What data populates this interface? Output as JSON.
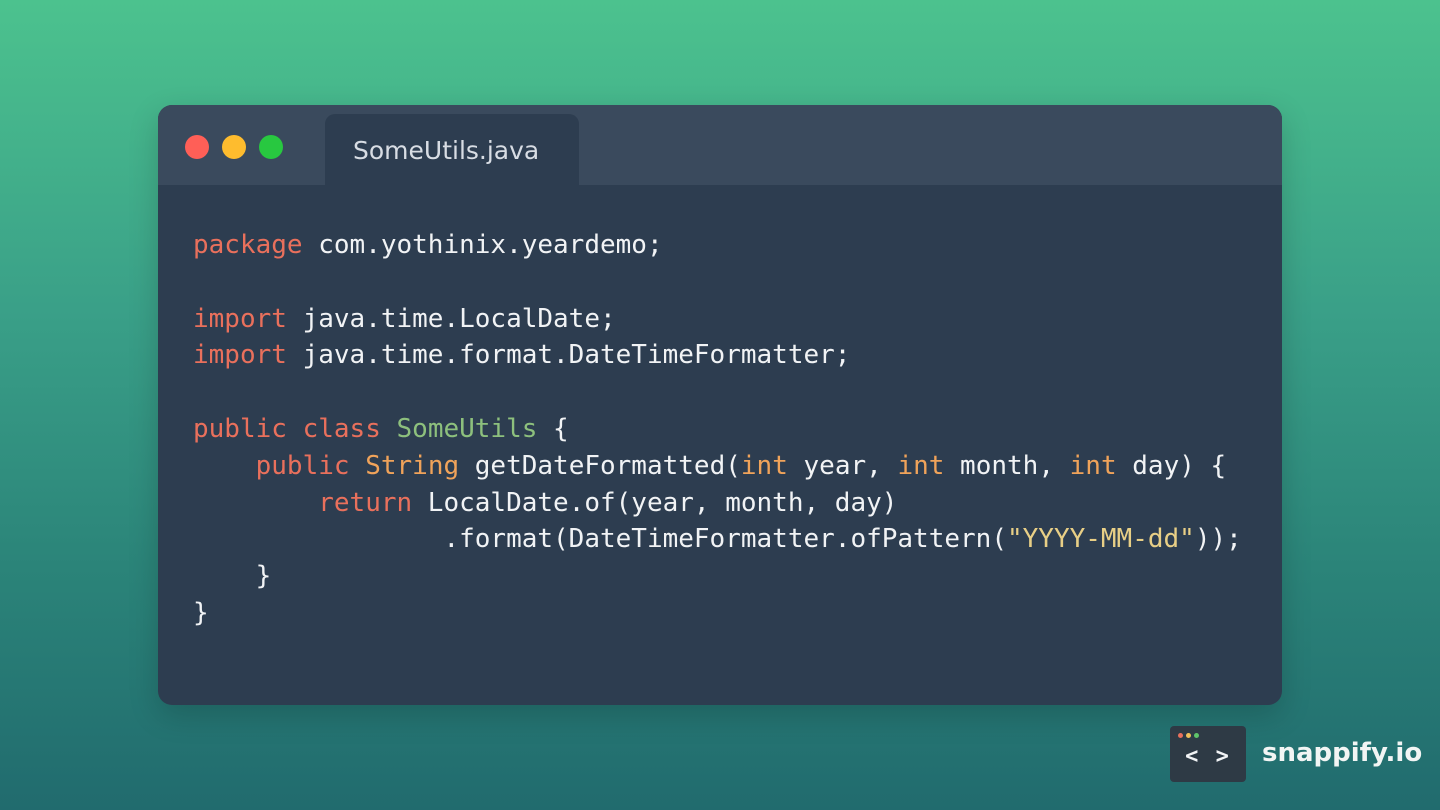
{
  "window": {
    "tab_title": "SomeUtils.java",
    "traffic_lights": [
      {
        "name": "close",
        "color": "#ff5f57"
      },
      {
        "name": "minimize",
        "color": "#febc2e"
      },
      {
        "name": "maximize",
        "color": "#28c840"
      }
    ]
  },
  "colors": {
    "keyword": "#e9705c",
    "type": "#f0a35a",
    "class_name": "#8dc07d",
    "string": "#e8cf86",
    "plain": "#f1f3f5",
    "editor_background": "#2d3d50",
    "titlebar_background": "#3a4a5d"
  },
  "code": {
    "language": "java",
    "lines": [
      [
        [
          "kw",
          "package"
        ],
        [
          "p",
          " com.yothinix.yeardemo;"
        ]
      ],
      [],
      [
        [
          "kw",
          "import"
        ],
        [
          "p",
          " java.time.LocalDate;"
        ]
      ],
      [
        [
          "kw",
          "import"
        ],
        [
          "p",
          " java.time.format.DateTimeFormatter;"
        ]
      ],
      [],
      [
        [
          "kw",
          "public"
        ],
        [
          "p",
          " "
        ],
        [
          "kw",
          "class"
        ],
        [
          "p",
          " "
        ],
        [
          "cls",
          "SomeUtils"
        ],
        [
          "p",
          " {"
        ]
      ],
      [
        [
          "p",
          "    "
        ],
        [
          "kw",
          "public"
        ],
        [
          "p",
          " "
        ],
        [
          "ty",
          "String"
        ],
        [
          "p",
          " getDateFormatted("
        ],
        [
          "ty",
          "int"
        ],
        [
          "p",
          " year, "
        ],
        [
          "ty",
          "int"
        ],
        [
          "p",
          " month, "
        ],
        [
          "ty",
          "int"
        ],
        [
          "p",
          " day) {"
        ]
      ],
      [
        [
          "p",
          "        "
        ],
        [
          "kw",
          "return"
        ],
        [
          "p",
          " LocalDate.of(year, month, day)"
        ]
      ],
      [
        [
          "p",
          "                .format(DateTimeFormatter.ofPattern("
        ],
        [
          "str",
          "\"YYYY-MM-dd\""
        ],
        [
          "p",
          "));"
        ]
      ],
      [
        [
          "p",
          "    }"
        ]
      ],
      [
        [
          "p",
          "}"
        ]
      ]
    ]
  },
  "brand": {
    "logo_glyph": "< >",
    "name": "snappify.io",
    "mini_dots": [
      "#e9705c",
      "#f0c05a",
      "#5fc46a"
    ]
  }
}
